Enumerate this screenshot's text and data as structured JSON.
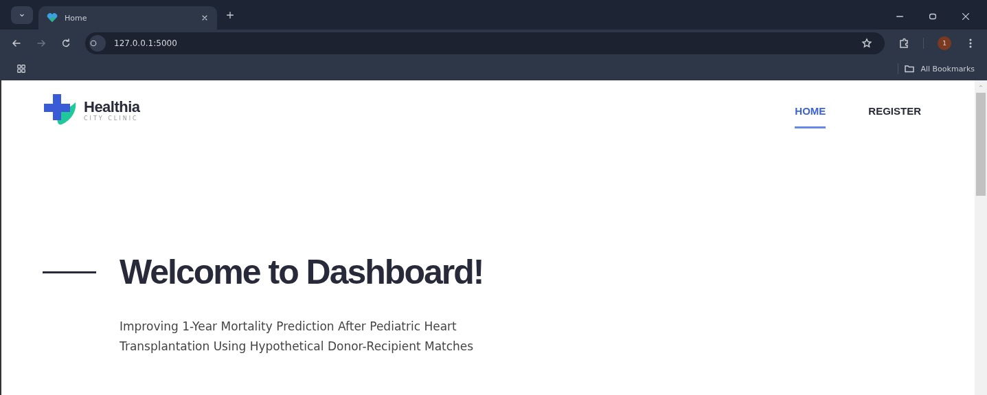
{
  "browser": {
    "tabs": [
      {
        "title": "Home",
        "selected": true
      }
    ],
    "url": "127.0.0.1:5000",
    "profile_initial": "1",
    "bookmarks_label": "All Bookmarks"
  },
  "site": {
    "logo": {
      "name": "Healthia",
      "tagline": "CITY CLINIC"
    },
    "nav": [
      {
        "label": "HOME",
        "selected": true
      },
      {
        "label": "REGISTER",
        "selected": false
      }
    ],
    "hero": {
      "title": "Welcome to Dashboard!",
      "subtitle": "Improving 1-Year Mortality Prediction After Pediatric Heart Transplantation Using Hypothetical Donor-Recipient Matches"
    }
  }
}
